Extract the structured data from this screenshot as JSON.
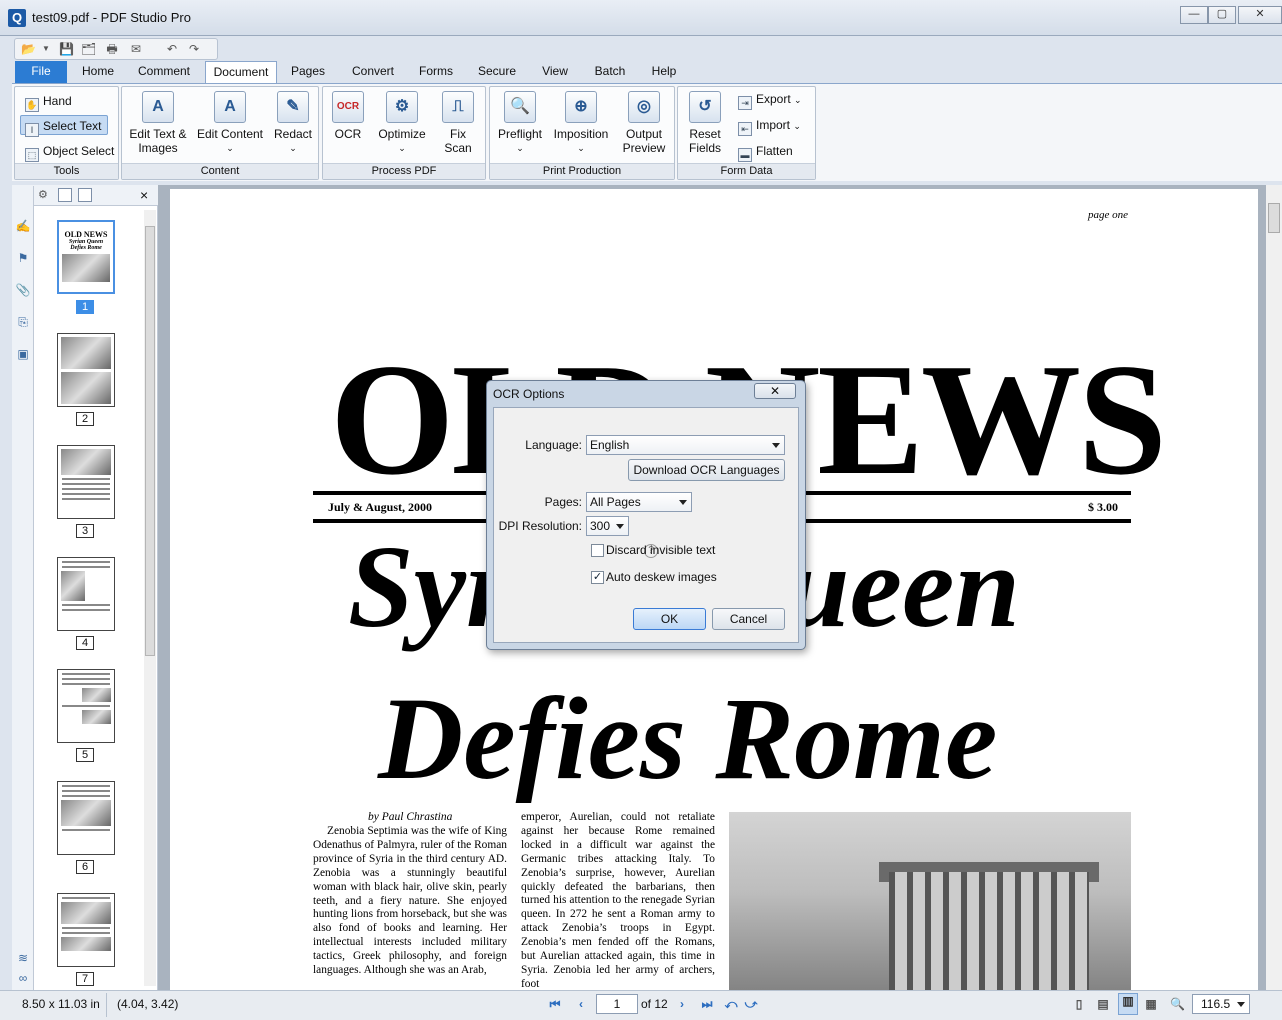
{
  "window": {
    "title": "test09.pdf - PDF Studio Pro",
    "app_icon": "Q",
    "minimize": "—",
    "maximize": "▢",
    "close": "✕"
  },
  "menu_tabs": [
    "File",
    "Home",
    "Comment",
    "Document",
    "Pages",
    "Convert",
    "Forms",
    "Secure",
    "View",
    "Batch",
    "Help"
  ],
  "active_tab": "Document",
  "ribbon": {
    "tools": {
      "label": "Tools",
      "hand": "Hand",
      "select_text": "Select Text",
      "object_select": "Object Select"
    },
    "content": {
      "label": "Content",
      "edit_text_images": "Edit Text &\nImages",
      "edit_content": "Edit Content",
      "redact": "Redact"
    },
    "process_pdf": {
      "label": "Process PDF",
      "ocr": "OCR",
      "optimize": "Optimize",
      "fix_scan": "Fix\nScan"
    },
    "print_production": {
      "label": "Print Production",
      "preflight": "Preflight",
      "imposition": "Imposition",
      "output_preview": "Output\nPreview"
    },
    "form_data": {
      "label": "Form Data",
      "reset_fields": "Reset\nFields",
      "export": "Export",
      "import": "Import",
      "flatten": "Flatten"
    }
  },
  "thumbnails": {
    "close": "×",
    "pages": [
      "1",
      "2",
      "3",
      "4",
      "5",
      "6",
      "7"
    ],
    "selected": "1",
    "thumb1": {
      "title": "OLD NEWS",
      "sub1": "Syrian Queen",
      "sub2": "Defies Rome"
    }
  },
  "document": {
    "page_label": "page one",
    "masthead": "OLD NEWS",
    "date": "July & August, 2000",
    "price": "$ 3.00",
    "headline1": "Syrian Queen",
    "headline2": "Defies Rome",
    "byline": "by Paul Chrastina",
    "col1": "Zenobia Septimia was the wife of King Odenathus of Palmyra, ruler of the Roman province of Syria in the third century AD. Zenobia was a stunningly beautiful woman with black hair, olive skin, pearly teeth, and a fiery nature. She enjoyed hunting lions from horseback, but she was also fond of books and learning. Her intellectual interests included military tactics, Greek philosophy, and foreign languages. Although she was an Arab,",
    "col2": "emperor, Aurelian, could not retaliate against her because Rome remained locked in a difficult war against the Germanic tribes attacking Italy. To Zenobia’s surprise, however, Aurelian quickly defeated the barbarians, then turned his attention to the renegade Syrian queen. In 272 he sent a Roman army to attack Zenobia’s troops in Egypt. Zenobia’s men fended off the Romans, but Aurelian attacked again, this time in Syria. Zenobia led her army of archers, foot"
  },
  "dialog": {
    "title": "OCR Options",
    "close": "✕",
    "language_label": "Language:",
    "language_value": "English",
    "download_button": "Download OCR Languages",
    "pages_label": "Pages:",
    "pages_value": "All Pages",
    "dpi_label": "DPI Resolution:",
    "dpi_value": "300",
    "help": "?",
    "discard_label": "Discard invisible text",
    "discard_checked": false,
    "deskew_label": "Auto deskew images",
    "deskew_checked": true,
    "ok": "OK",
    "cancel": "Cancel"
  },
  "status": {
    "page_size": "8.50 x 11.03 in",
    "coords": "(4.04, 3.42)",
    "page": "1",
    "of_pages": "of 12",
    "zoom": "116.5"
  }
}
